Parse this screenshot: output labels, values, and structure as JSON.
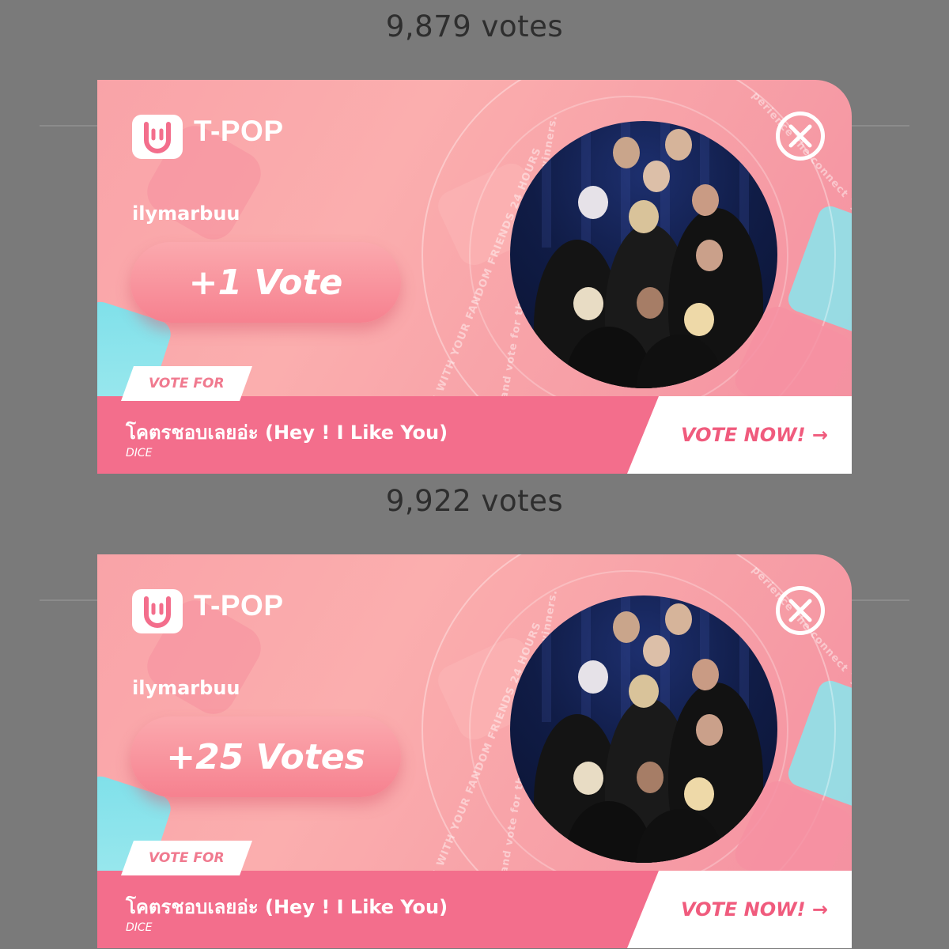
{
  "cards": [
    {
      "votes_above": "9,879 votes",
      "brand": "T-POP",
      "username": "ilymarbuu",
      "vote_amount": "+1 Vote",
      "vote_for_label": "VOTE FOR",
      "song_title": "โคตรชอบเลยอ่ะ (Hey ! I Like You)",
      "artist": "DICE",
      "vote_now_label": "VOTE NOW! →",
      "ring_text_left": "CES WITH YOUR FANDOM FRIENDS 24 HOURS",
      "ring_text_inner": "s and vote for them to be one of the winners.",
      "ring_text_right": "perience the connect \"you\" and your"
    },
    {
      "votes_above": "9,922 votes",
      "brand": "T-POP",
      "username": "ilymarbuu",
      "vote_amount": "+25 Votes",
      "vote_for_label": "VOTE FOR",
      "song_title": "โคตรชอบเลยอ่ะ (Hey ! I Like You)",
      "artist": "DICE",
      "vote_now_label": "VOTE NOW! →",
      "ring_text_left": "CES WITH YOUR FANDOM FRIENDS 24 HOURS",
      "ring_text_inner": "s and vote for them to be one of the winners.",
      "ring_text_right": "perience the connect \"you\" and your"
    }
  ],
  "colors": {
    "background": "#7a7a7a",
    "card_pink": "#f9a3a8",
    "song_bar": "#f36e8c",
    "accent": "#f05b7d",
    "cyan": "#8ee2ea"
  },
  "icons": {
    "logo": "rock-hand-icon",
    "close": "close-icon",
    "arrow": "arrow-right-icon"
  }
}
